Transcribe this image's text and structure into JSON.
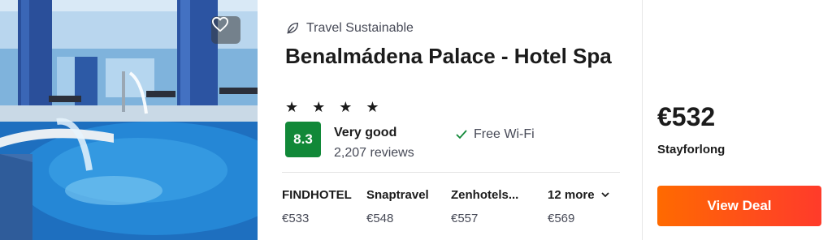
{
  "hotel": {
    "sustainability_label": "Travel Sustainable",
    "name": "Benalmádena Palace - Hotel Spa",
    "stars": "★ ★ ★ ★",
    "star_count": 4,
    "rating_score": "8.3",
    "rating_text": "Very good",
    "review_count": "2,207 reviews",
    "amenity": "Free Wi-Fi"
  },
  "providers": [
    {
      "name": "FINDHOTEL",
      "price": "€533"
    },
    {
      "name": "Snaptravel",
      "price": "€548"
    },
    {
      "name": "Zenhotels...",
      "price": "€557"
    }
  ],
  "more": {
    "label": "12 more",
    "price": "€569"
  },
  "deal": {
    "price": "€532",
    "provider": "Stayforlong",
    "button_label": "View Deal"
  },
  "icons": {
    "favorite": "heart-icon",
    "sustainability": "leaf-icon",
    "amenity": "check-icon",
    "more": "chevron-down-icon"
  },
  "colors": {
    "rating_badge": "#118838",
    "deal_button": "#ff5a14"
  }
}
